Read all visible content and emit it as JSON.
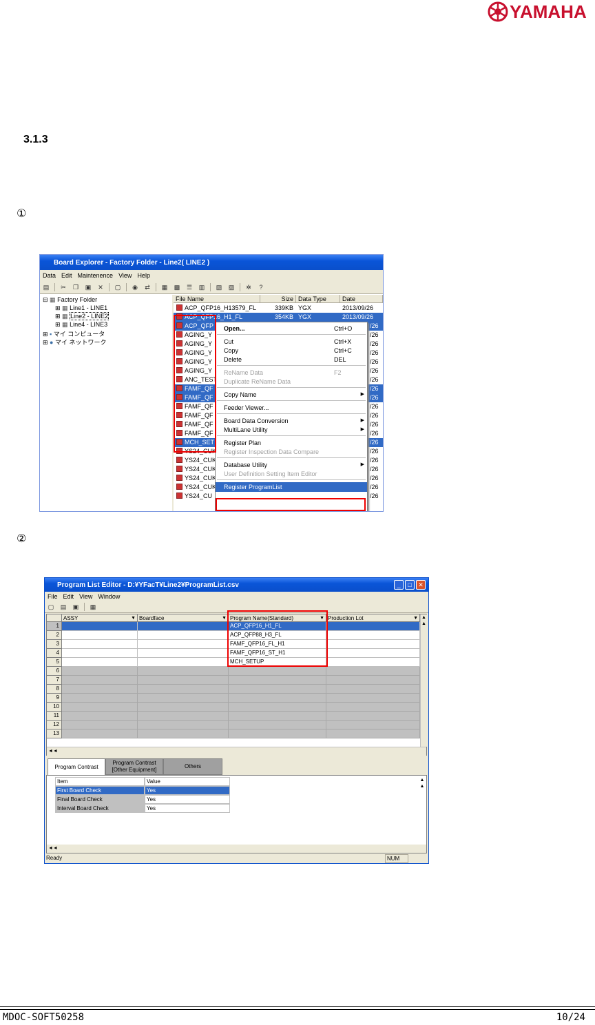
{
  "header": {
    "brand": "YAMAHA"
  },
  "section": {
    "number": "3.1.3"
  },
  "steps": [
    "①",
    "②"
  ],
  "board_explorer": {
    "title": "Board Explorer  -  Factory Folder - Line2( LINE2 )",
    "menu": [
      "Data",
      "Edit",
      "Maintenence",
      "View",
      "Help"
    ],
    "tree": {
      "root": "Factory Folder",
      "lines": [
        "Line1 - LINE1",
        "Line2 - LINE2",
        "Line4 - LINE3"
      ],
      "others": [
        "マイ コンピュータ",
        "マイ ネットワーク"
      ]
    },
    "columns": [
      "File Name",
      "Size",
      "Data Type",
      "Date"
    ],
    "files": [
      {
        "name": "ACP_QFP16_H13579_FL",
        "size": "339KB",
        "type": "YGX",
        "date": "2013/09/26",
        "selected": false
      },
      {
        "name": "ACP_QFP16_H1_FL",
        "size": "354KB",
        "type": "YGX",
        "date": "2013/09/26",
        "selected": true
      },
      {
        "name": "ACP_QFP",
        "size": "",
        "type": "",
        "date": "/26",
        "selected": true
      },
      {
        "name": "AGING_Y",
        "size": "",
        "type": "",
        "date": "/26",
        "selected": false
      },
      {
        "name": "AGING_Y",
        "size": "",
        "type": "",
        "date": "/26",
        "selected": false
      },
      {
        "name": "AGING_Y",
        "size": "",
        "type": "",
        "date": "/26",
        "selected": false
      },
      {
        "name": "AGING_Y",
        "size": "",
        "type": "",
        "date": "/26",
        "selected": false
      },
      {
        "name": "AGING_Y",
        "size": "",
        "type": "",
        "date": "/26",
        "selected": false
      },
      {
        "name": "ANC_TEST",
        "size": "",
        "type": "",
        "date": "/26",
        "selected": false
      },
      {
        "name": "FAMF_QF",
        "size": "",
        "type": "",
        "date": "/26",
        "selected": true
      },
      {
        "name": "FAMF_QF",
        "size": "",
        "type": "",
        "date": "/26",
        "selected": true
      },
      {
        "name": "FAMF_QF",
        "size": "",
        "type": "",
        "date": "/26",
        "selected": false
      },
      {
        "name": "FAMF_QF",
        "size": "",
        "type": "",
        "date": "/26",
        "selected": false
      },
      {
        "name": "FAMF_QF",
        "size": "",
        "type": "",
        "date": "/26",
        "selected": false
      },
      {
        "name": "FAMF_QF",
        "size": "",
        "type": "",
        "date": "/26",
        "selected": false
      },
      {
        "name": "MCH_SET",
        "size": "",
        "type": "",
        "date": "/26",
        "selected": true
      },
      {
        "name": "YS24_CUK",
        "size": "",
        "type": "",
        "date": "/26",
        "selected": false
      },
      {
        "name": "YS24_CUK",
        "size": "",
        "type": "",
        "date": "/26",
        "selected": false
      },
      {
        "name": "YS24_CUK",
        "size": "",
        "type": "",
        "date": "/26",
        "selected": false
      },
      {
        "name": "YS24_CUK",
        "size": "",
        "type": "",
        "date": "/26",
        "selected": false
      },
      {
        "name": "YS24_CUK",
        "size": "",
        "type": "",
        "date": "/26",
        "selected": false
      },
      {
        "name": "YS24_CU",
        "size": "",
        "type": "",
        "date": "/26",
        "selected": false
      }
    ],
    "context_menu": [
      {
        "label": "Open...",
        "shortcut": "Ctrl+O",
        "bold": true
      },
      {
        "label": "Cut",
        "shortcut": "Ctrl+X"
      },
      {
        "label": "Copy",
        "shortcut": "Ctrl+C"
      },
      {
        "label": "Delete",
        "shortcut": "DEL"
      },
      {
        "label": "ReName Data",
        "shortcut": "F2",
        "disabled": true
      },
      {
        "label": "Duplicate ReName Data",
        "shortcut": "",
        "disabled": true
      },
      {
        "label": "Copy Name",
        "submenu": true
      },
      {
        "label": "Feeder Viewer..."
      },
      {
        "label": "Board Data Conversion",
        "submenu": true
      },
      {
        "label": "MultiLane Utility",
        "submenu": true
      },
      {
        "label": "Register Plan"
      },
      {
        "label": "Register Inspection Data Compare",
        "disabled": true
      },
      {
        "label": "Database Utility",
        "submenu": true
      },
      {
        "label": "User Definition Setting Item Editor",
        "disabled": true
      },
      {
        "label": "Register ProgramList",
        "highlight": true
      }
    ]
  },
  "program_list_editor": {
    "title": "Program List Editor - D:¥YFacT¥Line2¥ProgramList.csv",
    "menu": [
      "File",
      "Edit",
      "View",
      "Window"
    ],
    "columns": [
      "ASSY",
      "Boardface",
      "Program Name(Standard)",
      "Production Lot"
    ],
    "rows": [
      {
        "n": "1",
        "program": "ACP_QFP16_H1_FL"
      },
      {
        "n": "2",
        "program": "ACP_QFP88_H3_FL"
      },
      {
        "n": "3",
        "program": "FAMF_QFP16_FL_H1"
      },
      {
        "n": "4",
        "program": "FAMF_QFP16_ST_H1"
      },
      {
        "n": "5",
        "program": "MCH_SETUP"
      },
      {
        "n": "6",
        "program": ""
      },
      {
        "n": "7",
        "program": ""
      },
      {
        "n": "8",
        "program": ""
      },
      {
        "n": "9",
        "program": ""
      },
      {
        "n": "10",
        "program": ""
      },
      {
        "n": "11",
        "program": ""
      },
      {
        "n": "12",
        "program": ""
      },
      {
        "n": "13",
        "program": ""
      }
    ],
    "tabs": [
      "Program Contrast",
      "Program Contrast [Other Equipment]",
      "Others"
    ],
    "prop_header": {
      "item": "Item",
      "value": "Value"
    },
    "props": [
      {
        "item": "First Board Check",
        "value": "Yes"
      },
      {
        "item": "Final Board Check",
        "value": "Yes"
      },
      {
        "item": "Interval Board Check",
        "value": "Yes"
      }
    ],
    "status": {
      "left": "Ready",
      "num": "NUM"
    }
  },
  "footer": {
    "doc_id": "MDOC-SOFT50258",
    "page": "10/24"
  }
}
